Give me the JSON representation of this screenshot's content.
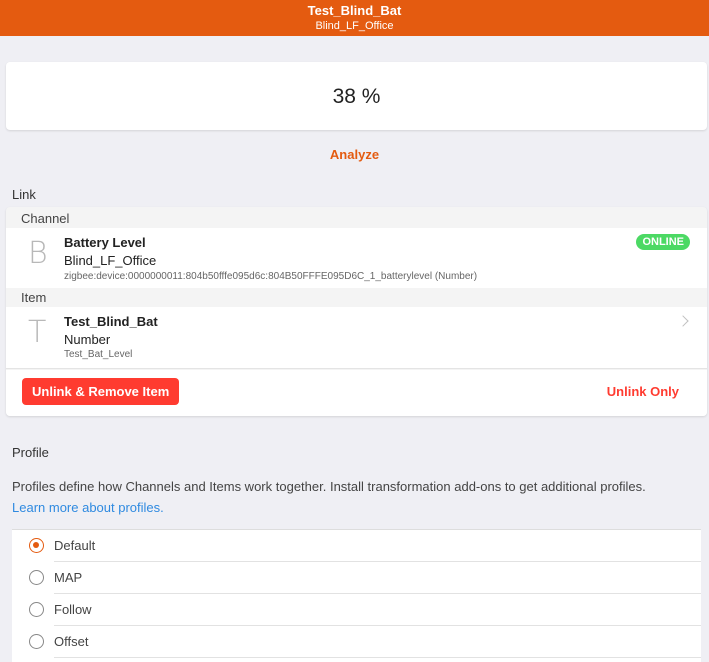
{
  "header": {
    "title": "Test_Blind_Bat",
    "subtitle": "Blind_LF_Office"
  },
  "state": {
    "value": "38 %"
  },
  "analyze_label": "Analyze",
  "link": {
    "title": "Link",
    "channel_header": "Channel",
    "channel": {
      "letter": "B",
      "title": "Battery Level",
      "subtitle": "Blind_LF_Office",
      "uid": "zigbee:device:0000000011:804b50fffe095d6c:804B50FFFE095D6C_1_batterylevel (Number)",
      "status": "ONLINE"
    },
    "item_header": "Item",
    "item": {
      "letter": "T",
      "title": "Test_Blind_Bat",
      "type": "Number",
      "label": "Test_Bat_Level"
    },
    "unlink_remove_label": "Unlink & Remove Item",
    "unlink_only_label": "Unlink Only"
  },
  "profile": {
    "title": "Profile",
    "description": "Profiles define how Channels and Items work together. Install transformation add-ons to get additional profiles.",
    "learn_more": "Learn more about profiles.",
    "options": [
      {
        "label": "Default",
        "checked": true
      },
      {
        "label": "MAP",
        "checked": false
      },
      {
        "label": "Follow",
        "checked": false
      },
      {
        "label": "Offset",
        "checked": false
      }
    ]
  },
  "colors": {
    "accent": "#e45b10",
    "danger": "#ff3b30",
    "online": "#4cd964",
    "link": "#2f8ae0"
  }
}
